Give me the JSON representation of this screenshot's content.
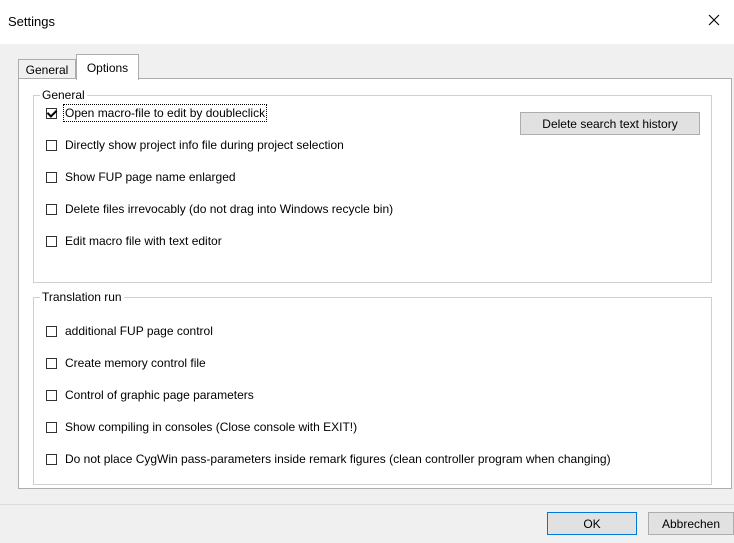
{
  "window": {
    "title": "Settings",
    "close_icon": "close-icon"
  },
  "tabs": [
    {
      "label": "General",
      "active": false
    },
    {
      "label": "Options",
      "active": true
    }
  ],
  "groups": {
    "general": {
      "legend": "General",
      "button_label": "Delete search text history",
      "options": [
        {
          "label": "Open macro-file to edit by doubleclick",
          "checked": true,
          "focused": true
        },
        {
          "label": "Directly show project info file during project selection",
          "checked": false
        },
        {
          "label": "Show FUP page name enlarged",
          "checked": false
        },
        {
          "label": "Delete files irrevocably (do not drag into Windows recycle bin)",
          "checked": false
        },
        {
          "label": "Edit macro file with text editor",
          "checked": false
        }
      ]
    },
    "translation": {
      "legend": "Translation run",
      "options": [
        {
          "label": "additional FUP page control",
          "checked": false
        },
        {
          "label": "Create memory control file",
          "checked": false
        },
        {
          "label": "Control of graphic page parameters",
          "checked": false
        },
        {
          "label": "Show compiling in consoles (Close console with EXIT!)",
          "checked": false
        },
        {
          "label": "Do not place CygWin pass-parameters inside remark figures (clean controller program when changing)",
          "checked": false
        }
      ]
    }
  },
  "footer": {
    "ok_label": "OK",
    "cancel_label": "Abbrechen"
  }
}
